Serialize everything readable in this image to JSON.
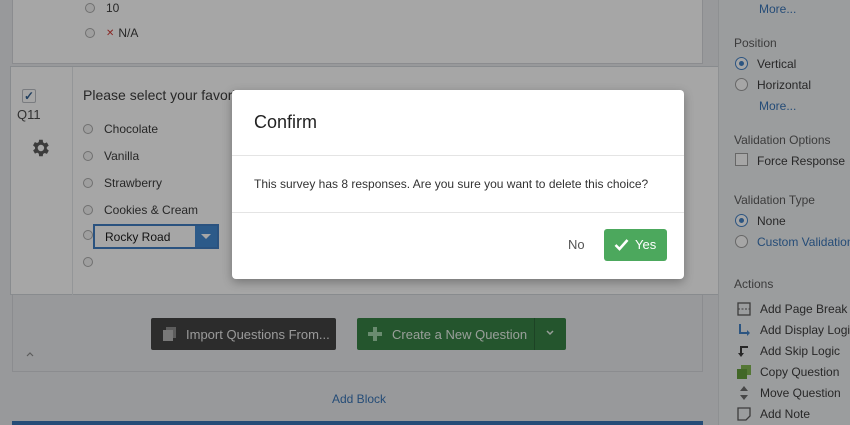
{
  "previous_question": {
    "choices": [
      {
        "label": "10",
        "na": false
      },
      {
        "label": "N/A",
        "na": true
      }
    ]
  },
  "question": {
    "number": "Q11",
    "text": "Please select your favorite",
    "choices": [
      "Chocolate",
      "Vanilla",
      "Strawberry",
      "Cookies & Cream"
    ],
    "editing_choice_value": "Rocky Road"
  },
  "toolbar": {
    "import_label": "Import Questions From...",
    "create_label": "Create a New Question",
    "add_block_label": "Add Block"
  },
  "panel": {
    "more_top": "More...",
    "position_heading": "Position",
    "position_options": [
      {
        "label": "Vertical",
        "selected": true
      },
      {
        "label": "Horizontal",
        "selected": false
      }
    ],
    "more_position": "More...",
    "validation_options_heading": "Validation Options",
    "force_response_label": "Force Response",
    "validation_type_heading": "Validation Type",
    "validation_types": [
      {
        "label": "None",
        "selected": true
      },
      {
        "label": "Custom Validation",
        "selected": false
      }
    ],
    "actions_heading": "Actions",
    "actions": [
      {
        "label": "Add Page Break",
        "icon": "page-break-icon"
      },
      {
        "label": "Add Display Logic",
        "icon": "display-logic-icon"
      },
      {
        "label": "Add Skip Logic",
        "icon": "skip-logic-icon"
      },
      {
        "label": "Copy Question",
        "icon": "copy-icon"
      },
      {
        "label": "Move Question",
        "icon": "move-icon"
      },
      {
        "label": "Add Note",
        "icon": "note-icon"
      }
    ]
  },
  "modal": {
    "title": "Confirm",
    "body": "This survey has 8 responses. Are you sure you want to delete this choice?",
    "no_label": "No",
    "yes_label": "Yes"
  },
  "colors": {
    "accent_blue": "#3b85d1",
    "yes_green": "#4ca85d",
    "create_green": "#2e7d3c",
    "import_dark": "#3b3b3b",
    "link_blue": "#2f6eb3"
  }
}
